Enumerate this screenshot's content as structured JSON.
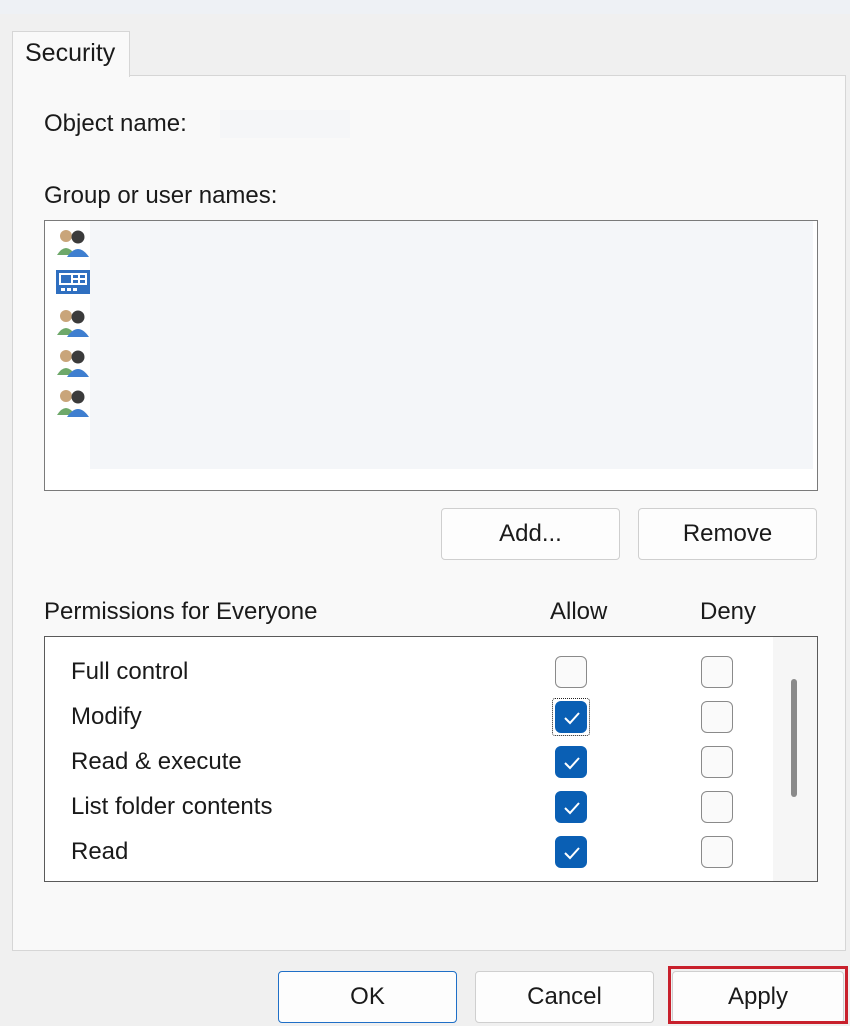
{
  "tab": {
    "label": "Security"
  },
  "object": {
    "label": "Object name:",
    "value": ""
  },
  "groups": {
    "label": "Group or user names:",
    "users": [
      {
        "icon": "group-icon",
        "name": ""
      },
      {
        "icon": "computer-account-icon",
        "name": ""
      },
      {
        "icon": "group-icon",
        "name": ""
      },
      {
        "icon": "group-icon",
        "name": ""
      },
      {
        "icon": "group-icon",
        "name": ""
      }
    ],
    "add_label": "Add...",
    "remove_label": "Remove"
  },
  "permissions": {
    "label": "Permissions for Everyone",
    "allow_label": "Allow",
    "deny_label": "Deny",
    "rows": [
      {
        "name": "Full control",
        "allow": false,
        "deny": false
      },
      {
        "name": "Modify",
        "allow": true,
        "deny": false,
        "focused": true
      },
      {
        "name": "Read & execute",
        "allow": true,
        "deny": false
      },
      {
        "name": "List folder contents",
        "allow": true,
        "deny": false
      },
      {
        "name": "Read",
        "allow": true,
        "deny": false
      },
      {
        "name": "",
        "allow": true,
        "deny": false
      }
    ]
  },
  "footer": {
    "ok_label": "OK",
    "cancel_label": "Cancel",
    "apply_label": "Apply"
  },
  "colors": {
    "accent": "#0a5fb4",
    "highlight": "#c8202c"
  }
}
